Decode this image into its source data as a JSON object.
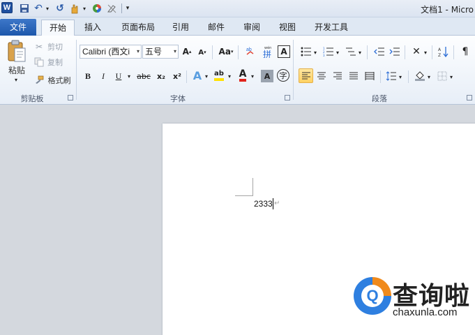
{
  "window": {
    "title": "文档1 - Micro"
  },
  "quick_access": {
    "logo": "W",
    "undo_icon": "↶",
    "redo_icon": "↺",
    "customize_icon": "▾"
  },
  "tabs": [
    {
      "label": "文件"
    },
    {
      "label": "开始"
    },
    {
      "label": "插入"
    },
    {
      "label": "页面布局"
    },
    {
      "label": "引用"
    },
    {
      "label": "邮件"
    },
    {
      "label": "审阅"
    },
    {
      "label": "视图"
    },
    {
      "label": "开发工具"
    }
  ],
  "clipboard": {
    "paste": "粘贴",
    "cut": "剪切",
    "copy": "复制",
    "format_painter": "格式刷",
    "group": "剪贴板"
  },
  "font": {
    "name": "Calibri (西文i",
    "size": "五号",
    "grow": "A",
    "shrink": "A",
    "case": "Aa",
    "bold": "B",
    "italic": "I",
    "underline": "U",
    "strike": "abc",
    "subscript": "x₂",
    "superscript": "x²",
    "effects": "A",
    "highlight": "ab",
    "color": "A",
    "shade": "A",
    "enclose": "字",
    "pinyin": "拼",
    "border_char": "A",
    "group": "字体"
  },
  "paragraph": {
    "group": "段落"
  },
  "document": {
    "text": "2333",
    "para_mark": "↵"
  },
  "watermark": {
    "cn": "查询啦",
    "en": "chaxunla.com",
    "mark": "Q"
  },
  "colors": {
    "file_tab": "#2a63b8",
    "highlight": "#ffe100",
    "font_color": "#e0231c",
    "accent": "#2e7fe0"
  }
}
